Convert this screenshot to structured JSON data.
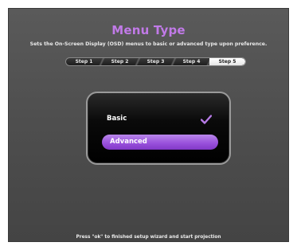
{
  "title": "Menu Type",
  "subtitle": "Sets the On-Screen Display (OSD) menus to basic or advanced type upon preference.",
  "steps": [
    {
      "label": "Step 1",
      "active": false
    },
    {
      "label": "Step 2",
      "active": false
    },
    {
      "label": "Step 3",
      "active": false
    },
    {
      "label": "Step 4",
      "active": false
    },
    {
      "label": "Step 5",
      "active": true
    }
  ],
  "options": [
    {
      "label": "Basic",
      "selected": true,
      "highlighted": false
    },
    {
      "label": "Advanced",
      "selected": false,
      "highlighted": true
    }
  ],
  "footer": "Press \"ok\" to finished setup wizard and start projection",
  "colors": {
    "accent_purple": "#c17ae8",
    "highlight_purple": "#9a52dc",
    "check_purple": "#b77be6",
    "panel_black": "#000000",
    "background_gray": "#4f4f4f"
  }
}
